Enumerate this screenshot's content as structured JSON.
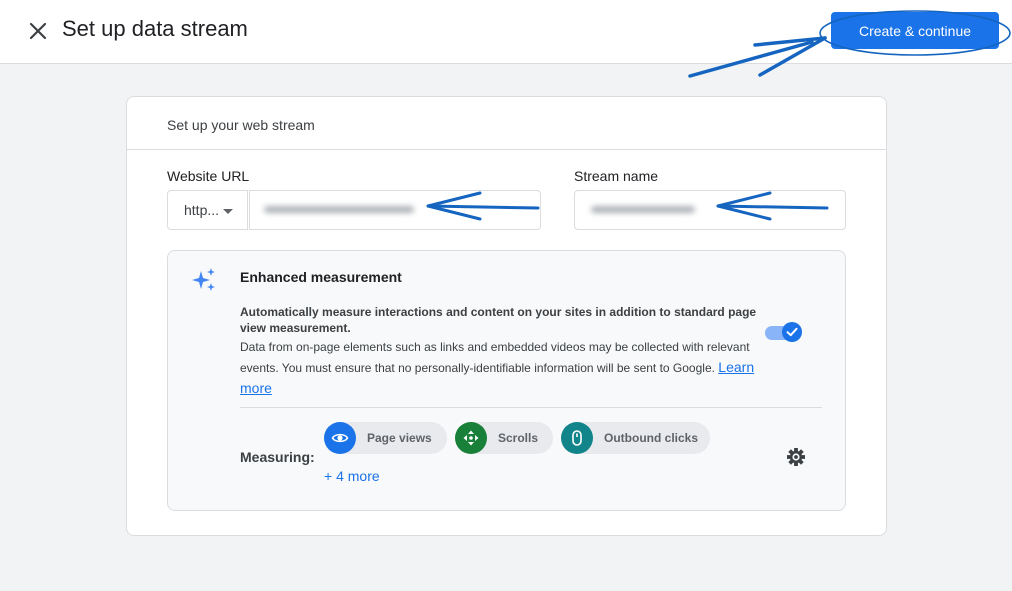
{
  "header": {
    "title": "Set up data stream",
    "primary_button": "Create & continue"
  },
  "card": {
    "title": "Set up your web stream",
    "website_url": {
      "label": "Website URL",
      "protocol": "http..."
    },
    "stream_name": {
      "label": "Stream name"
    }
  },
  "enhanced": {
    "title": "Enhanced measurement",
    "description_bold": "Automatically measure interactions and content on your sites in addition to standard page view measurement.",
    "description": "Data from on-page elements such as links and embedded videos may be collected with relevant events. You must ensure that no personally-identifiable information will be sent to Google.",
    "learn_more": "Learn more",
    "toggle_on": true,
    "measuring_label": "Measuring:",
    "chips": [
      {
        "label": "Page views",
        "icon": "eye-icon",
        "color": "#1a73e8"
      },
      {
        "label": "Scrolls",
        "icon": "scroll-arrows-icon",
        "color": "#188038"
      },
      {
        "label": "Outbound clicks",
        "icon": "mouse-icon",
        "color": "#12858a"
      }
    ],
    "more": "+ 4 more"
  },
  "colors": {
    "accent": "#1a73e8",
    "annotation": "#1565c0"
  }
}
